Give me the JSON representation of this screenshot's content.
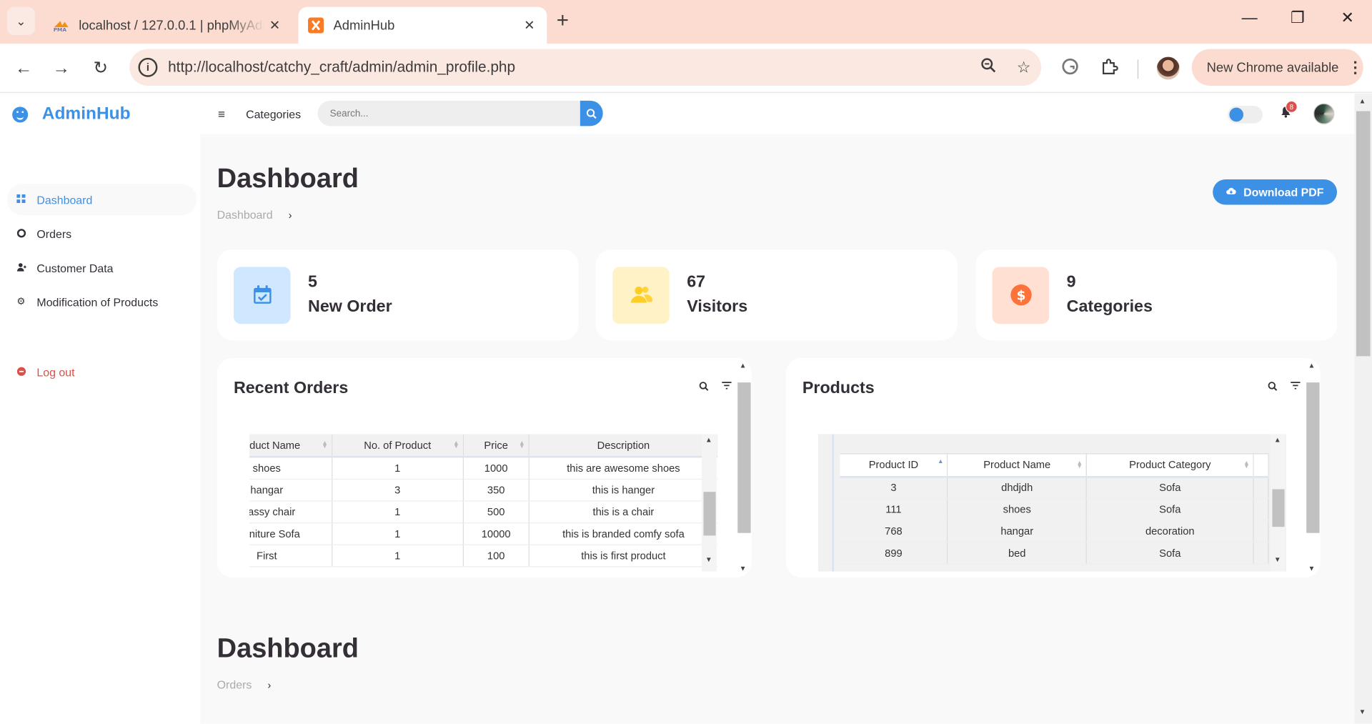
{
  "browser": {
    "tabs": [
      {
        "title": "localhost / 127.0.0.1 | phpMyAdmin",
        "icon": "phpmyadmin-icon"
      },
      {
        "title": "AdminHub",
        "icon": "xampp-icon"
      }
    ],
    "url": "http://localhost/catchy_craft/admin/admin_profile.php",
    "new_chrome_label": "New Chrome available"
  },
  "sidebar": {
    "brand": "AdminHub",
    "items": [
      {
        "label": "Dashboard",
        "icon": "dashboard-icon"
      },
      {
        "label": "Orders",
        "icon": "orders-icon"
      },
      {
        "label": "Customer Data",
        "icon": "user-icon"
      },
      {
        "label": "Modification of Products",
        "icon": "gear-icon"
      }
    ],
    "logout": "Log out"
  },
  "topnav": {
    "categories": "Categories",
    "search_placeholder": "Search...",
    "notification_count": "8"
  },
  "main": {
    "title": "Dashboard",
    "breadcrumb": "Dashboard",
    "download_label": "Download PDF",
    "cards": [
      {
        "value": "5",
        "label": "New Order",
        "icon": "calendar-check-icon",
        "bg": "#cfe8ff",
        "color": "#3c91e6"
      },
      {
        "value": "67",
        "label": "Visitors",
        "icon": "group-icon",
        "bg": "#fff2c6",
        "color": "#ffce26"
      },
      {
        "value": "9",
        "label": "Categories",
        "icon": "dollar-circle-icon",
        "bg": "#ffe0d3",
        "color": "#fd7238"
      }
    ],
    "recent_orders": {
      "title": "Recent Orders",
      "columns": [
        "Product Name",
        "No. of Product",
        "Price",
        "Description"
      ],
      "rows": [
        [
          "shoes",
          "1",
          "1000",
          "this are awesome shoes"
        ],
        [
          "hangar",
          "3",
          "350",
          "this is hanger"
        ],
        [
          "Classy chair",
          "1",
          "500",
          "this is a chair"
        ],
        [
          "Furniture Sofa",
          "1",
          "10000",
          "this is branded comfy sofa"
        ],
        [
          "First",
          "1",
          "100",
          "this is first product"
        ]
      ]
    },
    "products": {
      "title": "Products",
      "columns": [
        "Product ID",
        "Product Name",
        "Product Category"
      ],
      "rows": [
        [
          "3",
          "dhdjdh",
          "Sofa"
        ],
        [
          "111",
          "shoes",
          "Sofa"
        ],
        [
          "768",
          "hangar",
          "decoration"
        ],
        [
          "899",
          "bed",
          "Sofa"
        ]
      ]
    },
    "section2": {
      "title": "Dashboard",
      "breadcrumb": "Orders"
    }
  }
}
